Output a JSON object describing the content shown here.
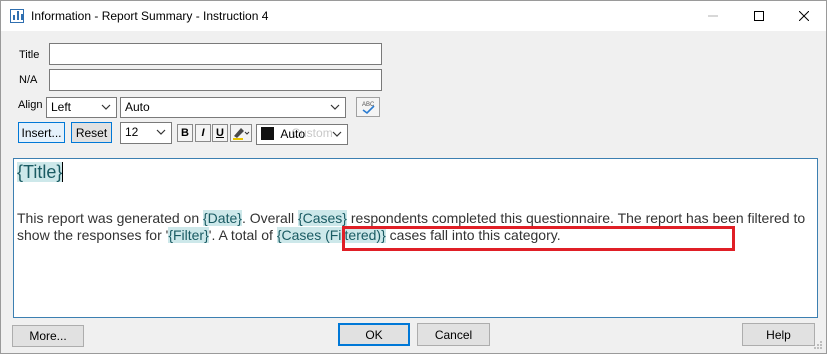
{
  "window": {
    "title": "Information - Report Summary - Instruction 4"
  },
  "form": {
    "title_label": "Title",
    "title_value": "",
    "na_label": "N/A",
    "na_value": "",
    "align_label": "Align",
    "align_value": "Left",
    "vertical_align_value": "Auto",
    "insert_label": "Insert...",
    "reset_label": "Reset",
    "font_size_value": "12",
    "bold_label": "B",
    "italic_label": "I",
    "underline_label": "U",
    "color_value": "Auto",
    "color_ghost": "Custom"
  },
  "editor": {
    "title_field": "{Title}",
    "p1": "This report was generated on ",
    "f_date": "{Date}",
    "p2": ". Overall ",
    "f_cases": "{Cases}",
    "p3": " respondents completed this questionnaire. The report has been filtered to show the responses for '",
    "f_filter": "{Filter}",
    "p4": "'. ",
    "p5": "A total of ",
    "f_cases_filtered": "{Cases (Filtered)}",
    "p6": " cases fall into this category."
  },
  "footer": {
    "more_label": "More...",
    "ok_label": "OK",
    "cancel_label": "Cancel",
    "help_label": "Help"
  },
  "colors": {
    "field_highlight": "#cde8ea",
    "annotation_box": "#e01f26",
    "accent": "#0078d7"
  },
  "icons": {
    "app": "bar-chart-icon",
    "spell": "spell-check-icon",
    "highlighter": "highlighter-icon"
  }
}
